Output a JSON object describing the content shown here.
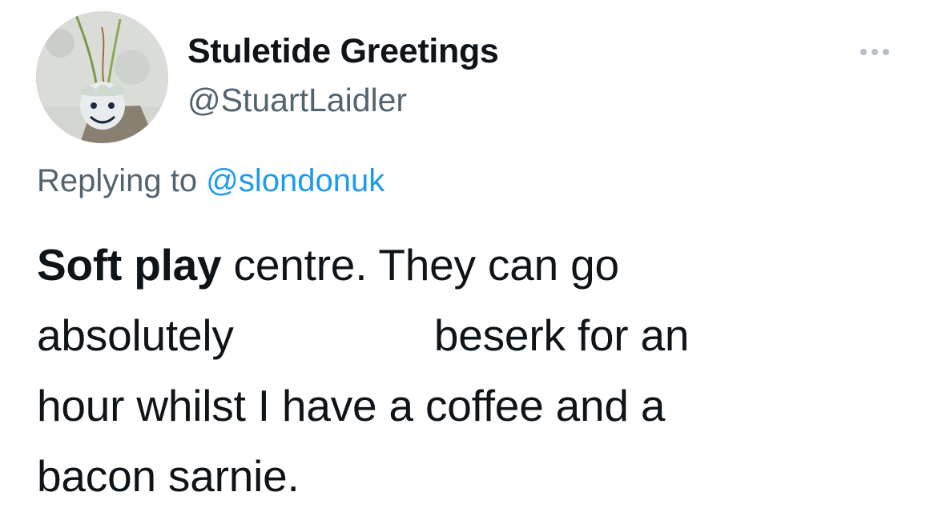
{
  "author": {
    "display_name": "Stuletide Greetings",
    "handle": "@StuartLaidler",
    "avatar_icon": "avatar-photo"
  },
  "menu": {
    "icon": "more-options-icon"
  },
  "reply_context": {
    "prefix": "Replying to",
    "mention": "@slondonuk"
  },
  "tweet": {
    "bold_lead": "Soft play",
    "line1_rest": " centre. They can go",
    "line2_start": "absolutely",
    "line2_end": "beserk for an",
    "line3": "hour whilst I have a coffee and a",
    "line4": "bacon sarnie."
  },
  "colors": {
    "text": "#0f1419",
    "secondary": "#536471",
    "link": "#1d9bf0"
  }
}
